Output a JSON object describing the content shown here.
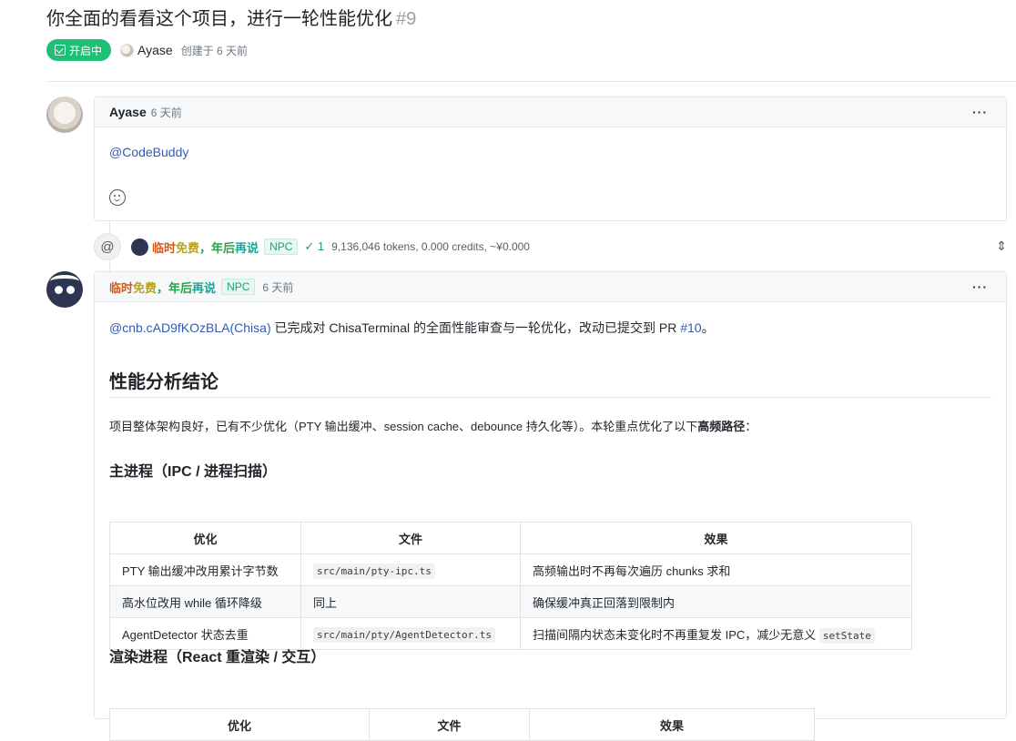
{
  "issue": {
    "title": "你全面的看看这个项目，进行一轮性能优化",
    "number": "#9",
    "status": "开启中",
    "author": "Ayase",
    "created": "创建于 6 天前"
  },
  "comment1": {
    "author": "Ayase",
    "time": "6 天前",
    "mention": "@CodeBuddy",
    "menu": "···"
  },
  "event": {
    "bot_name_parts": [
      "临时",
      "免费",
      "，年后",
      "再说"
    ],
    "npc": "NPC",
    "check": "✓ 1",
    "tokens": "9,136,046 tokens, 0.000 credits, ~¥0.000"
  },
  "comment2": {
    "name_parts": [
      "临时",
      "免费",
      "，年后",
      "再说"
    ],
    "npc": "NPC",
    "time": "6 天前",
    "menu": "···",
    "mention_link": "@cnb.cAD9fKOzBLA(Chisa)",
    "mention_text": " 已完成对 ChisaTerminal 的全面性能审查与一轮优化，改动已提交到 PR ",
    "pr_link": "#10",
    "mention_end": "。",
    "heading": "性能分析结论",
    "intro_pre": "项目整体架构良好，已有不少优化（PTY 输出缓冲、session cache、debounce 持久化等）。本轮重点优化了以下",
    "intro_bold": "高频路径",
    "intro_post": "：",
    "section1": "主进程（IPC / 进程扫描）",
    "section2": "渲染进程（React 重渲染 / 交互）",
    "table_headers": [
      "优化",
      "文件",
      "效果"
    ],
    "table1_rows": [
      {
        "opt": "PTY 输出缓冲改用累计字节数",
        "file": "src/main/pty-ipc.ts",
        "effect_text": "高频输出时不再每次遍历 chunks 求和",
        "effect_code": ""
      },
      {
        "opt": "高水位改用 while 循环降级",
        "file": "同上",
        "effect_text": "确保缓冲真正回落到限制内",
        "effect_code": ""
      },
      {
        "opt": "AgentDetector 状态去重",
        "file": "src/main/pty/AgentDetector.ts",
        "effect_text": "扫描间隔内状态未变化时不再重复发 IPC，减少无意义 ",
        "effect_code": "setState"
      }
    ]
  }
}
